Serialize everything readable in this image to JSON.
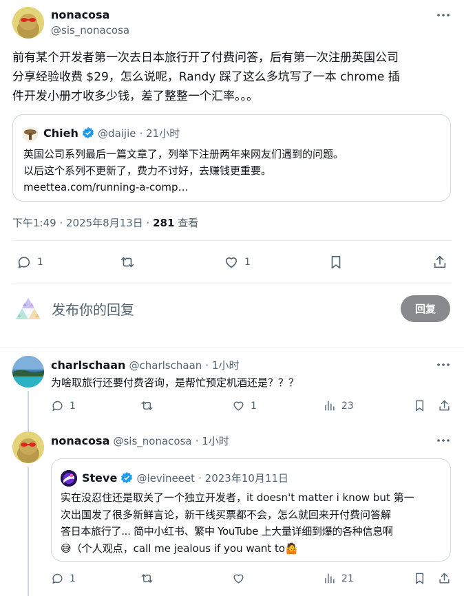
{
  "main_tweet": {
    "author_name": "nonacosa",
    "author_handle": "@sis_nonacosa",
    "text_line1": "前有某个开发者第一次去日本旅行开了付费问答，后有第一次注册英国公司",
    "text_line2": "分享经验收费 $29，怎么说呢，Randy 踩了这么多坑写了一本 chrome 插",
    "text_line3": "件开发小册才收多少钱，差了整整一个汇率。。。",
    "quote": {
      "author_name": "Chieh",
      "author_handle": "@daijie",
      "time": "· 21小时",
      "line1": "英国公司系列最后一篇文章了，列举下注册两年来网友们遇到的问题。",
      "line2": "以后这个系列不更新了，费力不讨好，去赚钱更重要。",
      "link": "meettea.com/running-a-comp…"
    },
    "timestamp": "下午1:49 · 2025年8月13日 · ",
    "views_count": "281",
    "views_label": " 查看",
    "actions": {
      "replies": "1",
      "likes": "1"
    }
  },
  "reply_composer": {
    "placeholder": "发布你的回复",
    "button_label": "回复"
  },
  "replies": [
    {
      "author_name": "charlschaan",
      "author_handle": "@charlschaan",
      "time": "· 1小时",
      "text": "为啥取旅行还要付费咨询，是帮忙预定机酒还是？？？",
      "replies": "1",
      "likes": "1",
      "views": "23"
    },
    {
      "author_name": "nonacosa",
      "author_handle": "@sis_nonacosa",
      "time": "· 1小时",
      "quote": {
        "author_name": "Steve",
        "author_handle": "@levineeet",
        "time": "· 2023年10月11日",
        "line1": "实在没忍住还是取关了一个独立开发者，it doesn't matter i know but 第一",
        "line2": "次出国发了很多新鲜言论，新干线买票都不会，怎么就回来开付费问答解",
        "line3": "答日本旅行了... 简中小红书、繁中 YouTube 上大量详细到爆的各种信息啊",
        "line4_emoji": "😅",
        "line4": "（个人观点，call me jealous if you want to",
        "line4_end_emoji": "🤷"
      },
      "replies": "1",
      "views": "21"
    }
  ],
  "icons": [
    "more-icon",
    "reply-icon",
    "retweet-icon",
    "like-icon",
    "bookmark-icon",
    "share-icon",
    "views-icon",
    "verified-icon"
  ],
  "colors": {
    "verified": "#1d9bf0",
    "muted": "#536471",
    "border": "#cfd9de",
    "reply_button": "#87898c"
  }
}
